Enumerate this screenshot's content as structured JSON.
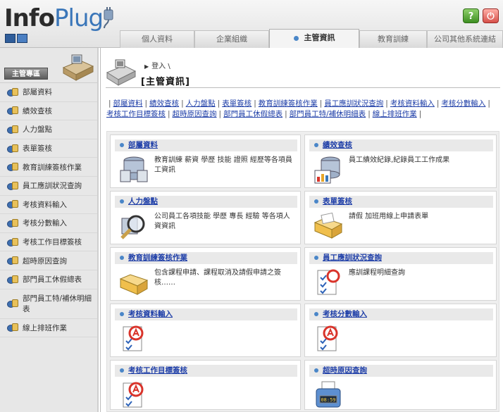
{
  "app": {
    "logo_part1": "Info",
    "logo_part2": "Plug",
    "help_glyph": "?",
    "power_glyph": "⏻"
  },
  "tabs": [
    {
      "label": "個人資料",
      "active": false
    },
    {
      "label": "企業組織",
      "active": false
    },
    {
      "label": "主管資訊",
      "active": true
    },
    {
      "label": "教育訓練",
      "active": false
    },
    {
      "label": "公司其他系統連結",
      "active": false
    }
  ],
  "sidebar": {
    "header": "主管專區",
    "items": [
      {
        "label": "部屬資料"
      },
      {
        "label": "績效查核"
      },
      {
        "label": "人力盤點"
      },
      {
        "label": "表單簽核"
      },
      {
        "label": "教育訓練簽核作業"
      },
      {
        "label": "員工應訓狀況查詢"
      },
      {
        "label": "考核資料輸入"
      },
      {
        "label": "考核分數輸入"
      },
      {
        "label": "考核工作目標簽核"
      },
      {
        "label": "超時原因查詢"
      },
      {
        "label": "部門員工休假總表"
      },
      {
        "label": "部門員工特/補休明細表"
      },
      {
        "label": "線上排班作業"
      }
    ]
  },
  "breadcrumb": "登入 \\",
  "page_title": "[主管資訊]",
  "quick_links": [
    "部屬資料",
    "績效查核",
    "人力盤點",
    "表單簽核",
    "教育訓練簽核作業",
    "員工應訓狀況查詢",
    "考核資料輸入",
    "考核分數輸入",
    "考核工作目標簽核",
    "超時原因查詢",
    "部門員工休假總表",
    "部門員工特/補休明細表",
    "線上排班作業"
  ],
  "cards": [
    {
      "title": "部屬資料",
      "desc": "教育訓練 薪資 學歷 技能 證照 經歷等各項員工資訊",
      "icon": "database-icon"
    },
    {
      "title": "績效查核",
      "desc": "員工績效紀錄,紀錄員工工作成果",
      "icon": "database-chart-icon"
    },
    {
      "title": "人力盤點",
      "desc": "公司員工各項技能 學歷 專長 經驗 等各項人資資訊",
      "icon": "magnifier-icon"
    },
    {
      "title": "表單簽核",
      "desc": "請假 加班用線上申請表單",
      "icon": "folder-icon"
    },
    {
      "title": "教育訓練簽核作業",
      "desc": "包含課程申請、課程取消及請假申請之簽核……",
      "icon": "folder-icon"
    },
    {
      "title": "員工應訓狀況查詢",
      "desc": "應訓課程明細查詢",
      "icon": "checklist-icon"
    },
    {
      "title": "考核資料輸入",
      "desc": "",
      "icon": "grade-sheet-icon"
    },
    {
      "title": "考核分數輸入",
      "desc": "",
      "icon": "grade-sheet-icon"
    },
    {
      "title": "考核工作目標簽核",
      "desc": "",
      "icon": "grade-sheet-icon"
    },
    {
      "title": "超時原因查詢",
      "desc": "",
      "icon": "time-clock-icon",
      "clock_text": "08:59"
    }
  ],
  "colors": {
    "accent": "#4a86c8",
    "link": "#1f3fa8",
    "logo_blue": "#3a76b9"
  }
}
